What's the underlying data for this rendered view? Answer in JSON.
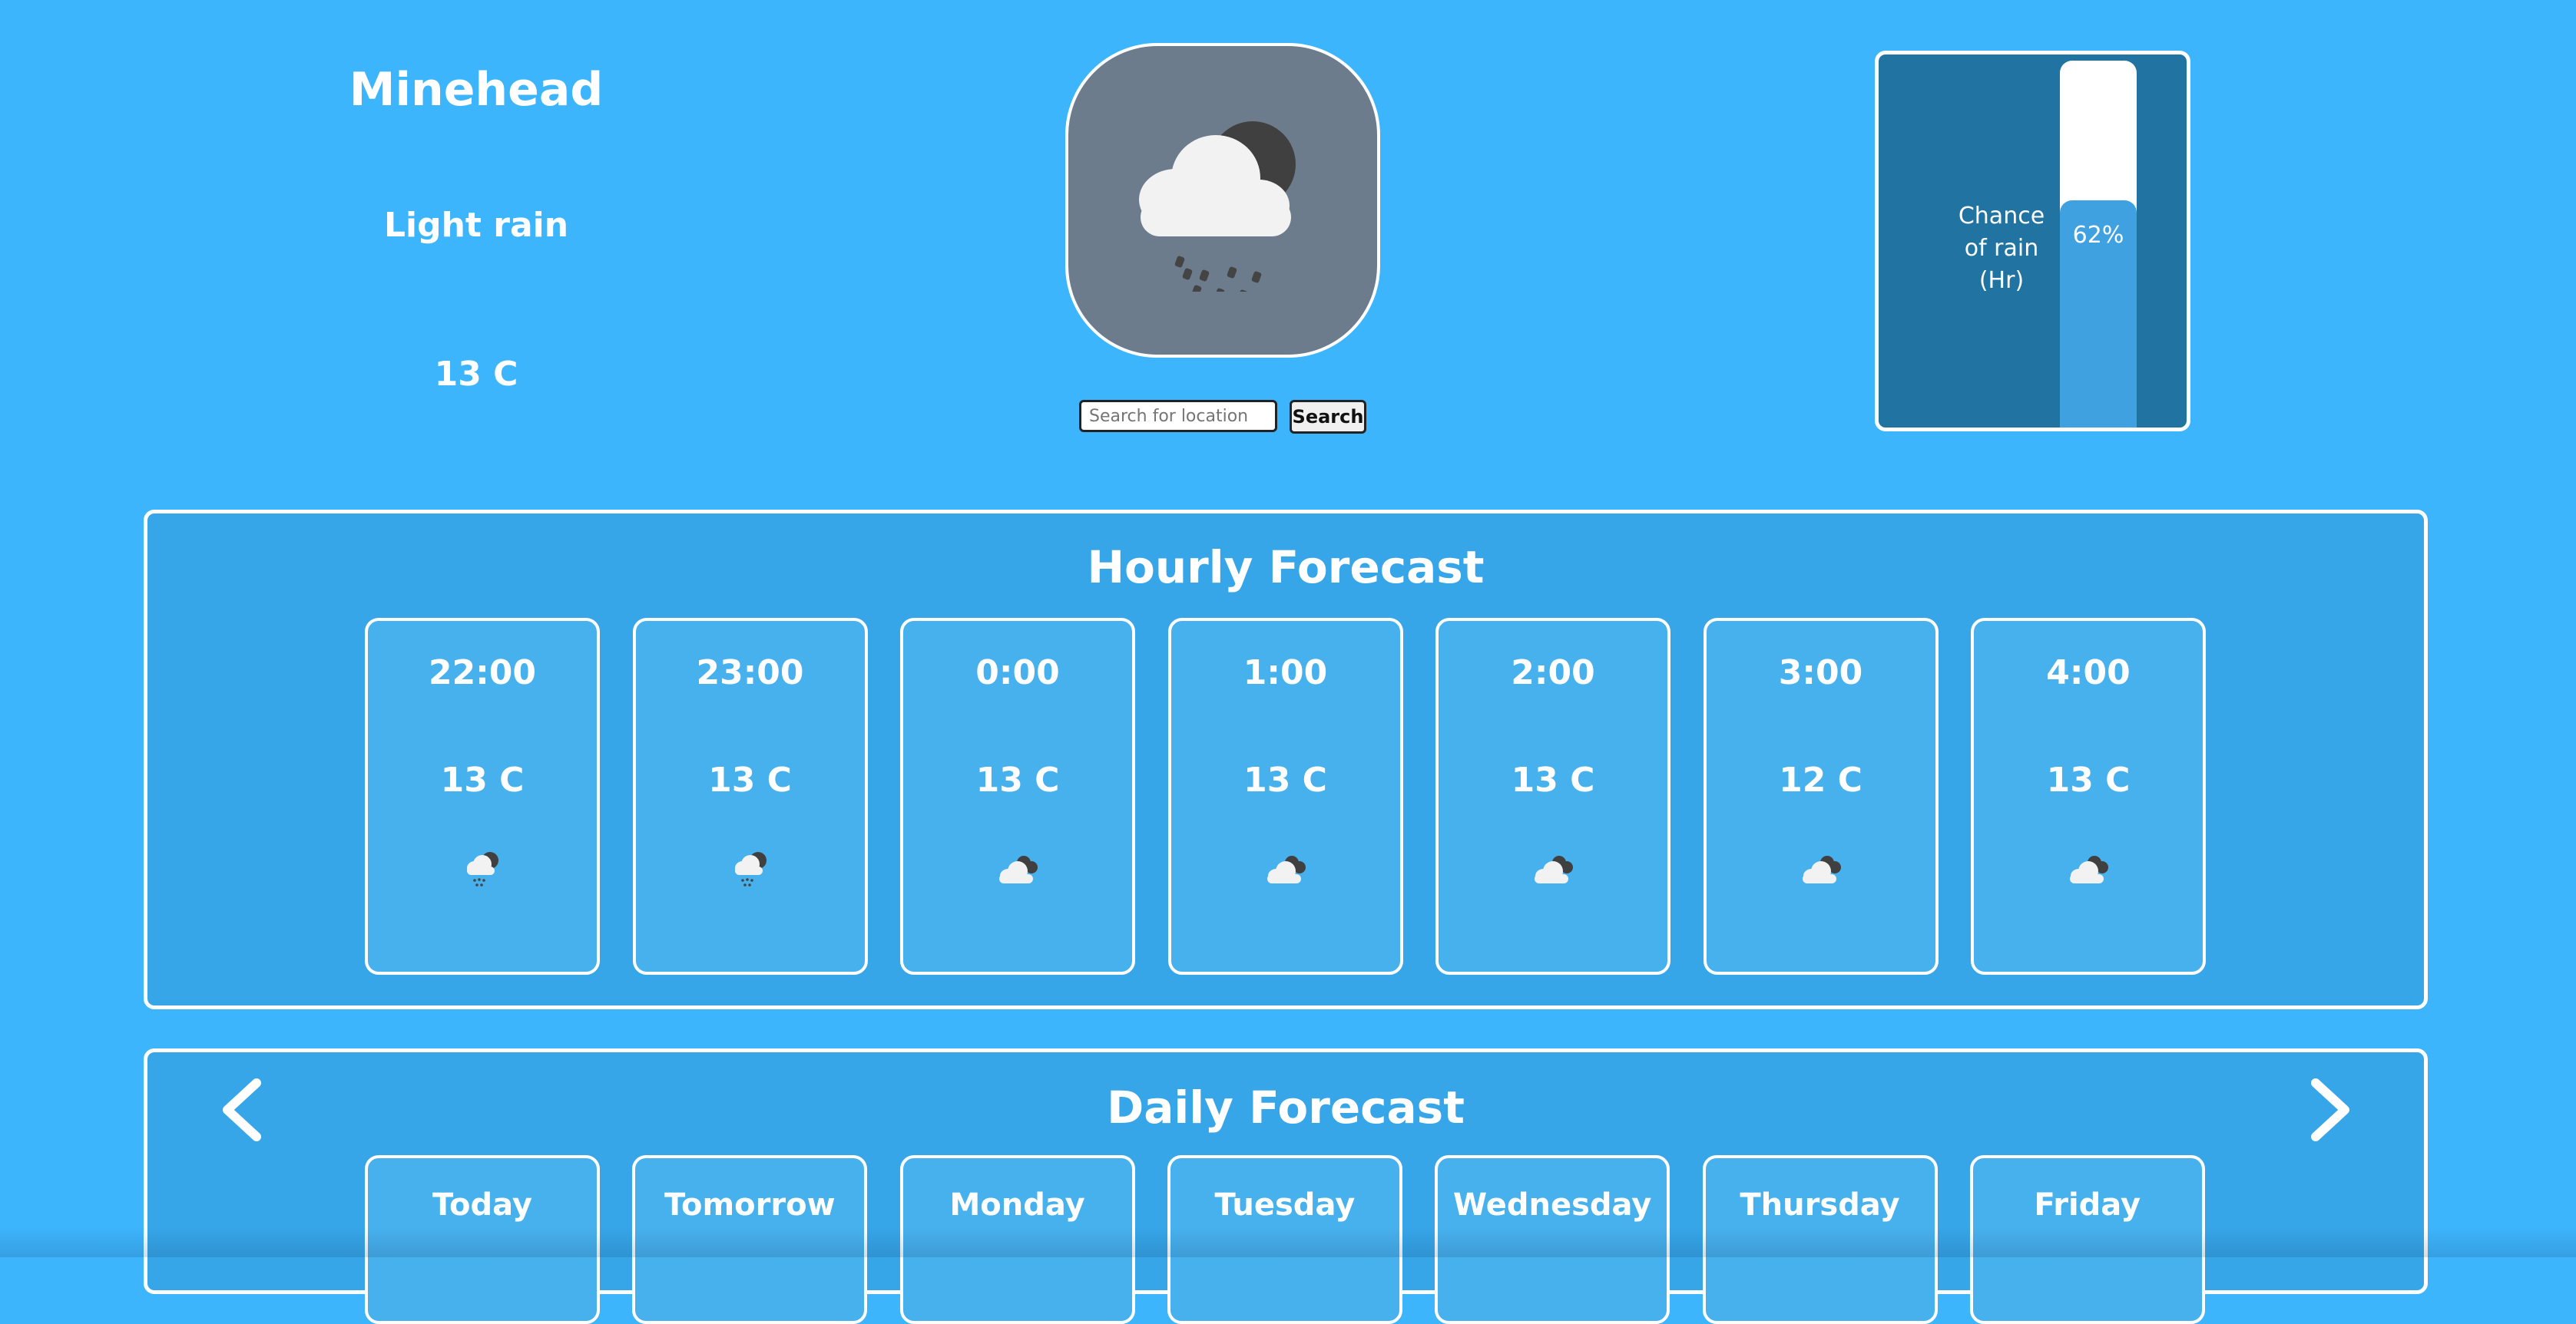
{
  "location": {
    "city": "Minehead",
    "condition": "Light rain",
    "temperature": "13 C",
    "icon": "cloud-moon-rain-icon"
  },
  "search": {
    "placeholder": "Search for location",
    "value": "",
    "button_label": "Search"
  },
  "rain_chance": {
    "label_lines": [
      "Chance",
      "of rain",
      "(Hr)"
    ],
    "value_text": "62%",
    "value": 0.62
  },
  "hourly": {
    "title": "Hourly Forecast",
    "items": [
      {
        "time": "22:00",
        "temp": "13 C",
        "icon": "cloud-moon-rain-icon"
      },
      {
        "time": "23:00",
        "temp": "13 C",
        "icon": "cloud-moon-rain-icon"
      },
      {
        "time": "0:00",
        "temp": "13 C",
        "icon": "cloud-moon-icon"
      },
      {
        "time": "1:00",
        "temp": "13 C",
        "icon": "cloud-moon-icon"
      },
      {
        "time": "2:00",
        "temp": "13 C",
        "icon": "cloud-moon-icon"
      },
      {
        "time": "3:00",
        "temp": "12 C",
        "icon": "cloud-moon-icon"
      },
      {
        "time": "4:00",
        "temp": "13 C",
        "icon": "cloud-moon-icon"
      }
    ]
  },
  "daily": {
    "title": "Daily Forecast",
    "prev_icon": "chevron-left-icon",
    "next_icon": "chevron-right-icon",
    "days": [
      {
        "name": "Today"
      },
      {
        "name": "Tomorrow"
      },
      {
        "name": "Monday"
      },
      {
        "name": "Tuesday"
      },
      {
        "name": "Wednesday"
      },
      {
        "name": "Thursday"
      },
      {
        "name": "Friday"
      }
    ]
  },
  "colors": {
    "background": "#3db5fd",
    "panel": "#36a6e9",
    "card": "#47b1ee",
    "rain_box": "#2173a2",
    "rain_fill": "#40a1e0",
    "icon_box": "#6c7c8c"
  }
}
